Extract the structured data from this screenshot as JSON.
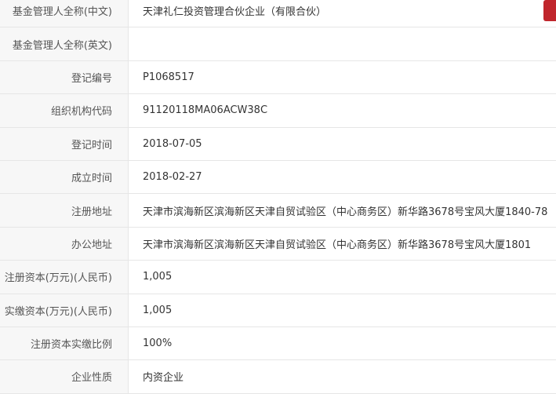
{
  "rows": [
    {
      "label": "基金管理人全称(中文)",
      "value": "天津礼仁投资管理合伙企业（有限合伙）"
    },
    {
      "label": "基金管理人全称(英文)",
      "value": ""
    },
    {
      "label": "登记编号",
      "value": "P1068517"
    },
    {
      "label": "组织机构代码",
      "value": "91120118MA06ACW38C"
    },
    {
      "label": "登记时间",
      "value": "2018-07-05"
    },
    {
      "label": "成立时间",
      "value": "2018-02-27"
    },
    {
      "label": "注册地址",
      "value": "天津市滨海新区滨海新区天津自贸试验区（中心商务区）新华路3678号宝风大厦1840-78"
    },
    {
      "label": "办公地址",
      "value": "天津市滨海新区滨海新区天津自贸试验区（中心商务区）新华路3678号宝风大厦1801"
    },
    {
      "label": "注册资本(万元)(人民币)",
      "value": "1,005"
    },
    {
      "label": "实缴资本(万元)(人民币)",
      "value": "1,005"
    },
    {
      "label": "注册资本实缴比例",
      "value": "100%"
    },
    {
      "label": "企业性质",
      "value": "内资企业"
    }
  ],
  "colors": {
    "accent": "#c0262c",
    "label_bg": "#f7f7f7",
    "border": "#e6e6e6"
  }
}
